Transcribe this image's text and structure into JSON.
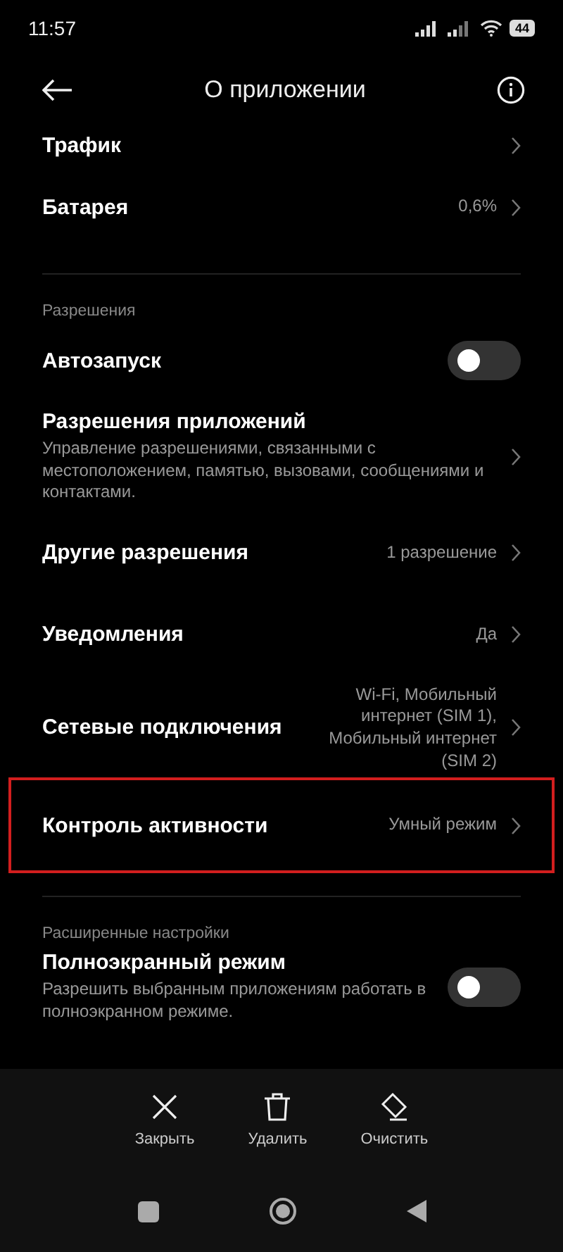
{
  "status_bar": {
    "time": "11:57",
    "battery": "44"
  },
  "header": {
    "title": "О приложении"
  },
  "groups": [
    {
      "items": [
        {
          "kind": "link",
          "title": "Трафик",
          "highlighted": false
        },
        {
          "kind": "link",
          "title": "Батарея",
          "value": "0,6%",
          "highlighted": false
        }
      ]
    },
    {
      "header": "Разрешения",
      "items": [
        {
          "kind": "toggle",
          "title": "Автозапуск",
          "on": false,
          "highlighted": false
        },
        {
          "kind": "link",
          "title": "Разрешения приложений",
          "subtitle": "Управление разрешениями, связанными с местоположением, памятью, вызовами, сообщениями и контактами.",
          "highlighted": false
        },
        {
          "kind": "link",
          "title": "Другие разрешения",
          "value": "1 разрешение",
          "highlighted": false
        },
        {
          "kind": "link",
          "title": "Уведомления",
          "value": "Да",
          "highlighted": false
        },
        {
          "kind": "link",
          "title": "Сетевые подключения",
          "value": "Wi-Fi, Мобильный интернет (SIM 1), Мобильный интернет (SIM 2)",
          "highlighted": false
        },
        {
          "kind": "link",
          "title": "Контроль активности",
          "value": "Умный режим",
          "highlighted": true
        }
      ]
    },
    {
      "header": "Расширенные настройки",
      "items": [
        {
          "kind": "toggle",
          "title": "Полноэкранный режим",
          "subtitle": "Разрешить выбранным приложениям работать в полноэкранном режиме.",
          "on": false,
          "highlighted": false
        }
      ]
    }
  ],
  "actions": [
    {
      "kind": "close",
      "label": "Закрыть"
    },
    {
      "kind": "delete",
      "label": "Удалить"
    },
    {
      "kind": "clear",
      "label": "Очистить"
    }
  ]
}
